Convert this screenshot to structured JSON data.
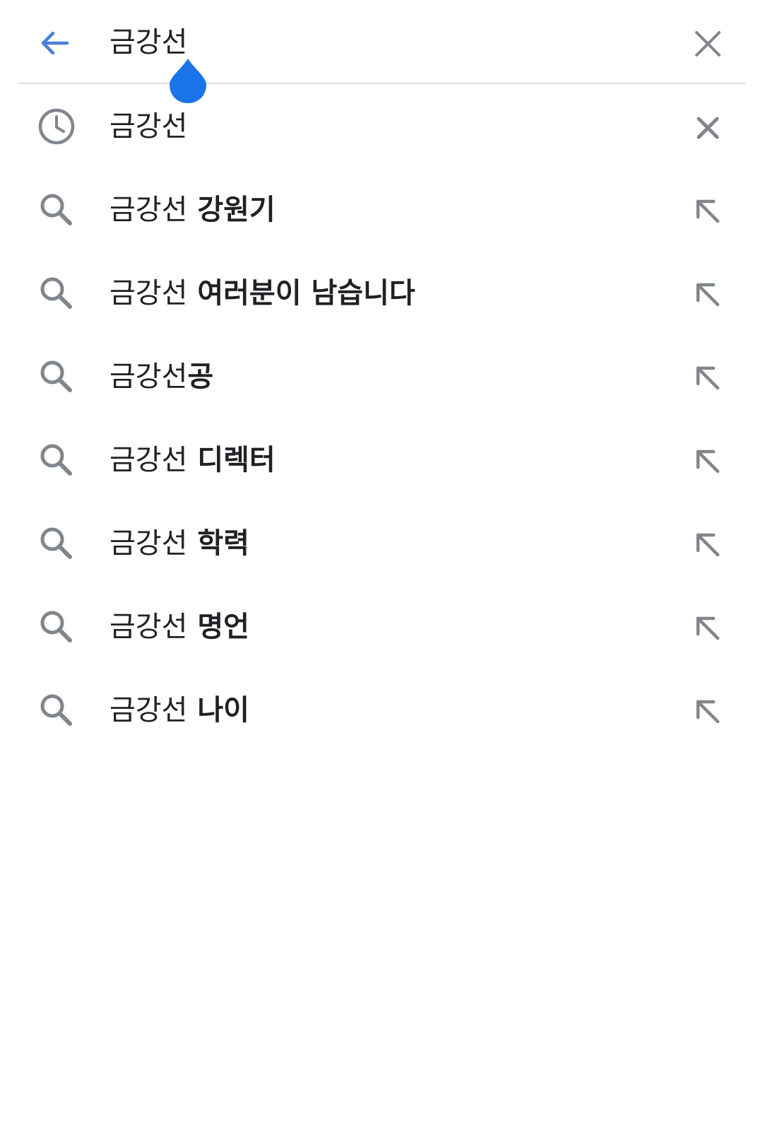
{
  "search": {
    "query": "금강선"
  },
  "icons": {
    "back": "arrow-back-icon",
    "clear": "close-icon",
    "history": "history-clock-icon",
    "search": "search-icon",
    "fill": "arrow-up-left-icon",
    "remove": "close-icon",
    "cursor": "text-cursor-handle"
  },
  "colors": {
    "accent": "#1a73e8",
    "back_arrow": "#4c7fd6",
    "text": "#202124",
    "icon_gray": "#80868b",
    "divider": "#dadce0"
  },
  "suggestions": [
    {
      "prefix": "금강선",
      "suffix": "",
      "type": "history"
    },
    {
      "prefix": "금강선",
      "suffix": " 강원기",
      "type": "search"
    },
    {
      "prefix": "금강선",
      "suffix": " 여러분이 남습니다",
      "type": "search"
    },
    {
      "prefix": "금강선",
      "suffix": "공",
      "type": "search"
    },
    {
      "prefix": "금강선",
      "suffix": " 디렉터",
      "type": "search"
    },
    {
      "prefix": "금강선",
      "suffix": " 학력",
      "type": "search"
    },
    {
      "prefix": "금강선",
      "suffix": " 명언",
      "type": "search"
    },
    {
      "prefix": "금강선",
      "suffix": " 나이",
      "type": "search"
    }
  ]
}
